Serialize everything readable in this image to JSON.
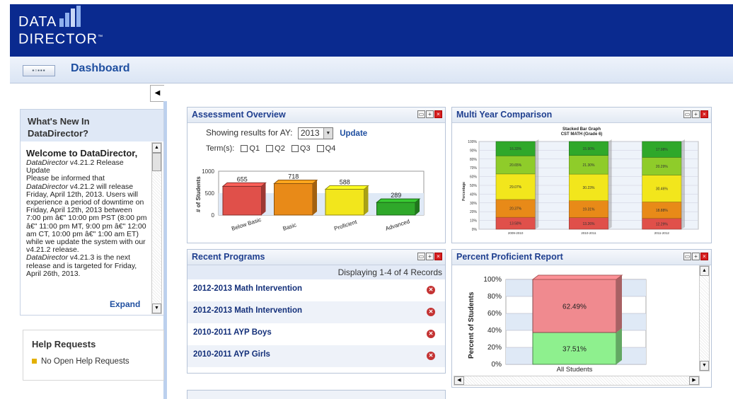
{
  "header": {
    "logo_line1": "DATA",
    "logo_line2": "DIRECTOR",
    "logo_tm": "™"
  },
  "toolbar": {
    "grid_button": "▪▫▪▪▪",
    "title": "Dashboard"
  },
  "sidebar": {
    "whats_new": {
      "title_line1": "What's New In",
      "title_line2": "DataDirector?",
      "welcome_title": "Welcome to DataDirector,",
      "release_brand": "DataDirector",
      "release_text": " v4.21.2 Release Update",
      "para1_a": "Please be informed that ",
      "para1_brand": "DataDirector",
      "para1_b": " v4.21.2 will release Friday, April 12th, 2013. Users will experience a period of downtime on Friday, April 12th, 2013 between 7:00 pm â€\" 10:00 pm PST (8:00 pm â€\" 11:00 pm MT, 9:00 pm â€\" 12:00 am CT, 10:00 pm â€\" 1:00 am ET) while we update the system with our v4.21.2 release.",
      "para2_brand": "DataDirector",
      "para2_text": " v4.21.3 is the next release and is targeted for Friday, April 26th, 2013.",
      "expand_label": "Expand"
    },
    "help": {
      "title": "Help Requests",
      "item": "No Open Help Requests"
    }
  },
  "panels": {
    "assessment": {
      "title": "Assessment Overview",
      "showing_label": "Showing results for AY:",
      "ay_value": "2013",
      "update_label": "Update",
      "terms_label": "Term(s):",
      "terms": [
        "Q1",
        "Q2",
        "Q3",
        "Q4"
      ]
    },
    "multiyear": {
      "title": "Multi Year Comparison"
    },
    "recent": {
      "title": "Recent Programs",
      "displaying": "Displaying 1-4 of 4 Records",
      "rows": [
        "2012-2013 Math Intervention",
        "2012-2013 Math Intervention",
        "2010-2011 AYP Boys",
        "2010-2011 AYP Girls"
      ]
    },
    "proficient": {
      "title": "Percent Proficient Report"
    }
  },
  "chart_data": [
    {
      "type": "bar",
      "ylabel": "# of Students",
      "ylim": [
        0,
        1000
      ],
      "yticks": [
        "1000",
        "500",
        "0"
      ],
      "categories": [
        "Below Basic",
        "Basic",
        "Proficient",
        "Advanced"
      ],
      "values": [
        655,
        718,
        588,
        289
      ],
      "colors": [
        "#e0504a",
        "#e88a18",
        "#f2e61c",
        "#2fa82a"
      ]
    },
    {
      "type": "bar",
      "title": "Stacked Bar Graph",
      "subtitle": "CST MATH (Grade 6)",
      "ylabel": "Percentage",
      "yticks": [
        "100%",
        "90%",
        "80%",
        "70%",
        "60%",
        "50%",
        "40%",
        "30%",
        "20%",
        "10%",
        "0%"
      ],
      "categories": [
        "2009-2010",
        "2010-2011",
        "2011-2012"
      ],
      "series": [
        {
          "values": [
            13.58,
            13.26,
            12.29
          ],
          "labels": [
            "13.58%",
            "13.26%",
            "12.29%"
          ],
          "color": "#e0504a"
        },
        {
          "values": [
            20.37,
            19.31,
            18.88
          ],
          "labels": [
            "20.37%",
            "19.31%",
            "18.88%"
          ],
          "color": "#e88a18"
        },
        {
          "values": [
            29.07,
            30.23,
            30.46
          ],
          "labels": [
            "29.07%",
            "30.23%",
            "30.46%"
          ],
          "color": "#f2e61c"
        },
        {
          "values": [
            20.65,
            21.3,
            20.29
          ],
          "labels": [
            "20.65%",
            "21.30%",
            "20.29%"
          ],
          "color": "#8fcc2a"
        },
        {
          "values": [
            16.33,
            15.9,
            17.98
          ],
          "labels": [
            "16.33%",
            "15.90%",
            "17.98%"
          ],
          "color": "#2fa82a"
        }
      ]
    },
    {
      "type": "bar",
      "ylabel": "Percent of Students",
      "yticks": [
        "100%",
        "80%",
        "60%",
        "40%",
        "20%",
        "0%"
      ],
      "categories": [
        "All Students"
      ],
      "series": [
        {
          "values": [
            37.51
          ],
          "labels": [
            "37.51%"
          ],
          "color": "#8ef08e"
        },
        {
          "values": [
            62.49
          ],
          "labels": [
            "62.49%"
          ],
          "color": "#f08a8f"
        }
      ]
    }
  ]
}
